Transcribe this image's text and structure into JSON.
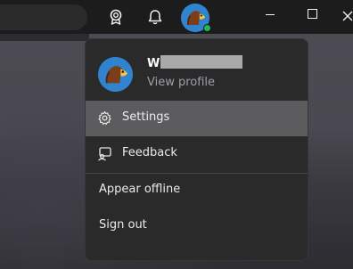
{
  "titlebar": {
    "search_icon": "search-pill",
    "achievements_icon": "trophy-icon",
    "notifications_icon": "bell-icon",
    "avatar_icon": "hedgehog-avatar",
    "minimize_icon": "minimize-icon",
    "maximize_icon": "maximize-icon",
    "close_icon": "close-icon",
    "status_color": "#1db954"
  },
  "menu": {
    "profile_name": "Wi",
    "view_profile_label": "View profile",
    "items": [
      {
        "label": "Settings",
        "icon": "gear-icon",
        "highlighted": true
      },
      {
        "label": "Feedback",
        "icon": "feedback-icon",
        "highlighted": false
      },
      {
        "label": "Appear offline",
        "icon": "",
        "highlighted": false
      },
      {
        "label": "Sign out",
        "icon": "",
        "highlighted": false
      }
    ],
    "colors": {
      "highlight": "#5c5c5e",
      "avatar_bg": "#2f83cf"
    }
  }
}
